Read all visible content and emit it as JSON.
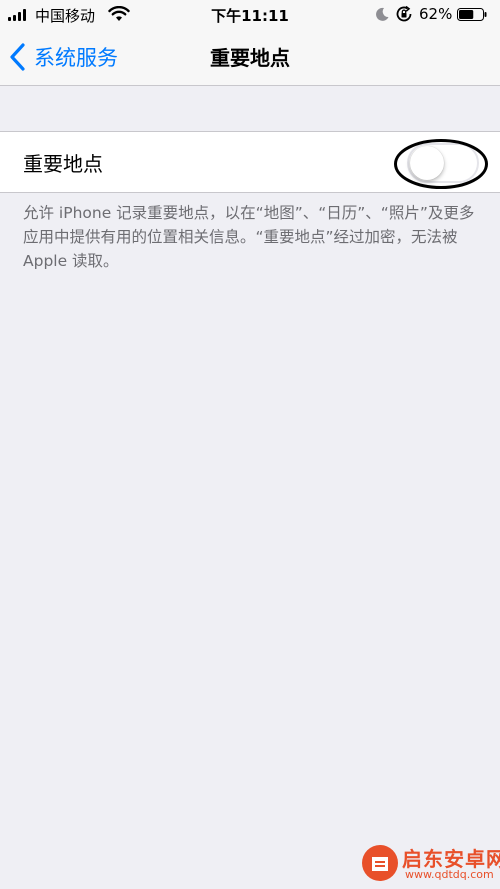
{
  "status_bar": {
    "carrier": "中国移动",
    "time": "下午11:11",
    "battery_percent": "62%",
    "battery_level": 0.62
  },
  "nav": {
    "back_label": "系统服务",
    "title": "重要地点"
  },
  "setting": {
    "label": "重要地点",
    "toggle_on": false
  },
  "description": "允许 iPhone 记录重要地点，以在“地图”、“日历”、“照片”及更多应用中提供有用的位置相关信息。“重要地点”经过加密，无法被 Apple 读取。",
  "watermark": {
    "title": "启东安卓网",
    "url": "www.qdtdq.com"
  },
  "colors": {
    "accent": "#007aff",
    "background": "#efeff4",
    "annotation": "#000000",
    "watermark": "#e8502a"
  }
}
